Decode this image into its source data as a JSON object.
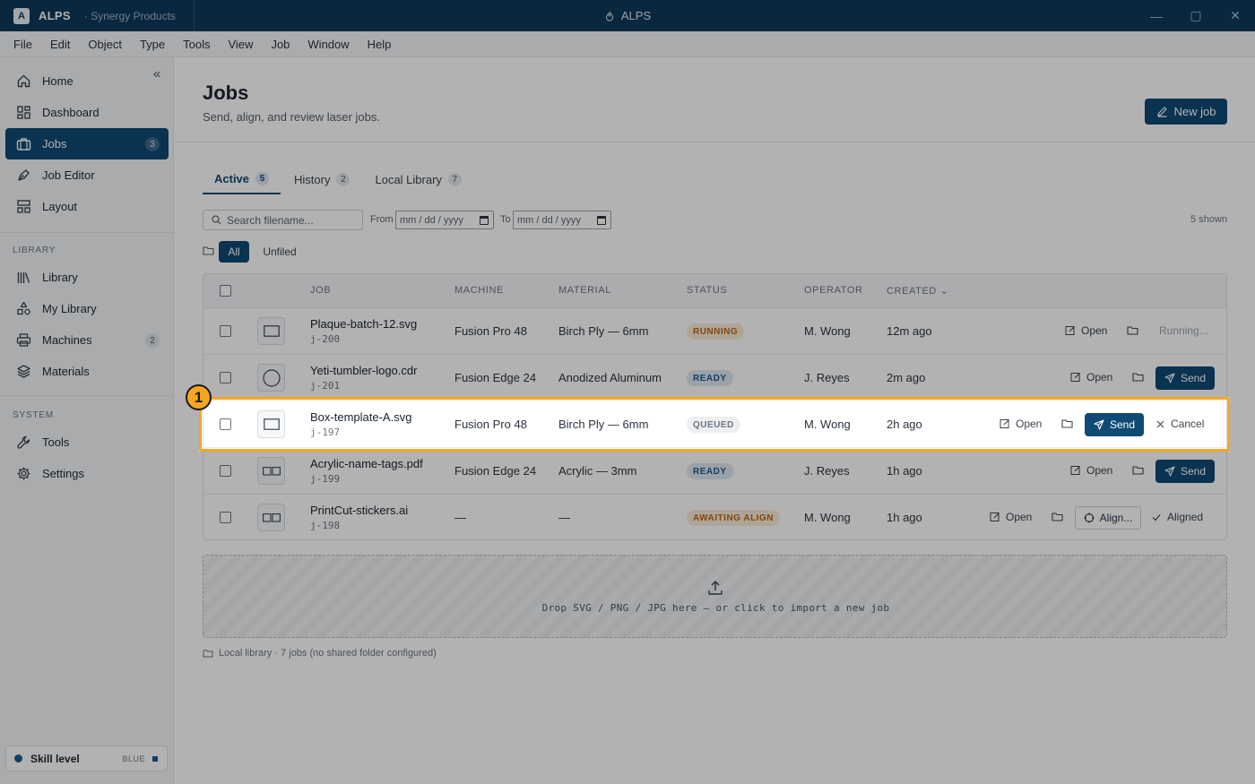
{
  "titlebar": {
    "logo_letter": "A",
    "app_name": "ALPS",
    "org": "· Synergy Products",
    "center_title": "ALPS",
    "controls": [
      "—",
      "▢",
      "✕"
    ]
  },
  "menu": [
    "File",
    "Edit",
    "Object",
    "Type",
    "Tools",
    "View",
    "Job",
    "Window",
    "Help"
  ],
  "sidebar": {
    "collapse_icon": "«",
    "nav_main": [
      {
        "label": "Home",
        "icon": "home-icon"
      },
      {
        "label": "Dashboard",
        "icon": "dashboard-icon"
      },
      {
        "label": "Jobs",
        "icon": "briefcase-icon",
        "badge": "3",
        "active": true
      },
      {
        "label": "Job Editor",
        "icon": "pen-tool-icon"
      },
      {
        "label": "Layout",
        "icon": "layout-icon"
      }
    ],
    "library_section": "LIBRARY",
    "nav_library": [
      {
        "label": "Library",
        "icon": "books-icon"
      },
      {
        "label": "My Library",
        "icon": "shapes-icon"
      },
      {
        "label": "Machines",
        "icon": "printer-icon",
        "badge": "2"
      },
      {
        "label": "Materials",
        "icon": "layers-icon"
      }
    ],
    "system_section": "SYSTEM",
    "nav_system": [
      {
        "label": "Tools",
        "icon": "wrench-icon"
      },
      {
        "label": "Settings",
        "icon": "gear-icon"
      }
    ],
    "skill": {
      "label": "Skill level",
      "value": "BLUE"
    }
  },
  "page": {
    "title": "Jobs",
    "subtitle": "Send, align, and review laser jobs.",
    "new_job_label": "New job"
  },
  "tabs": [
    {
      "label": "Active",
      "count": "5",
      "active": true
    },
    {
      "label": "History",
      "count": "2"
    },
    {
      "label": "Local Library",
      "count": "7"
    }
  ],
  "filters": {
    "search_placeholder": "Search filename...",
    "from_label": "From",
    "to_label": "To",
    "date_placeholder": "mm / dd / yyyy",
    "shown": "5 shown",
    "chips": [
      "All",
      "Unfiled"
    ]
  },
  "table": {
    "headers": {
      "job": "JOB",
      "machine": "MACHINE",
      "material": "MATERIAL",
      "status": "STATUS",
      "operator": "OPERATOR",
      "created": "CREATED"
    },
    "rows": [
      {
        "name": "Plaque-batch-12.svg",
        "id": "j-200",
        "machine": "Fusion Pro 48",
        "material": "Birch Ply — 6mm",
        "status": "RUNNING",
        "operator": "M. Wong",
        "created": "12m ago",
        "open": "Open",
        "action": "Running..."
      },
      {
        "name": "Yeti-tumbler-logo.cdr",
        "id": "j-201",
        "machine": "Fusion Edge 24",
        "material": "Anodized Aluminum",
        "status": "READY",
        "operator": "J. Reyes",
        "created": "2m ago",
        "open": "Open",
        "action": "Send"
      },
      {
        "name": "Box-template-A.svg",
        "id": "j-197",
        "machine": "Fusion Pro 48",
        "material": "Birch Ply — 6mm",
        "status": "QUEUED",
        "operator": "M. Wong",
        "created": "2h ago",
        "open": "Open",
        "action": "Send",
        "extra": "Cancel"
      },
      {
        "name": "Acrylic-name-tags.pdf",
        "id": "j-199",
        "machine": "Fusion Edge 24",
        "material": "Acrylic — 3mm",
        "status": "READY",
        "operator": "J. Reyes",
        "created": "1h ago",
        "open": "Open",
        "action": "Send"
      },
      {
        "name": "PrintCut-stickers.ai",
        "id": "j-198",
        "machine": "—",
        "material": "—",
        "status": "AWAITING ALIGN",
        "operator": "M. Wong",
        "created": "1h ago",
        "open": "Open",
        "action": "Align...",
        "extra": "Aligned"
      }
    ]
  },
  "dropzone": {
    "text": "Drop SVG / PNG / JPG here — or click to import a new job"
  },
  "footer_note": "Local library · 7 jobs (no shared folder configured)",
  "highlight": {
    "marker": "1",
    "color": "#f5a623"
  }
}
